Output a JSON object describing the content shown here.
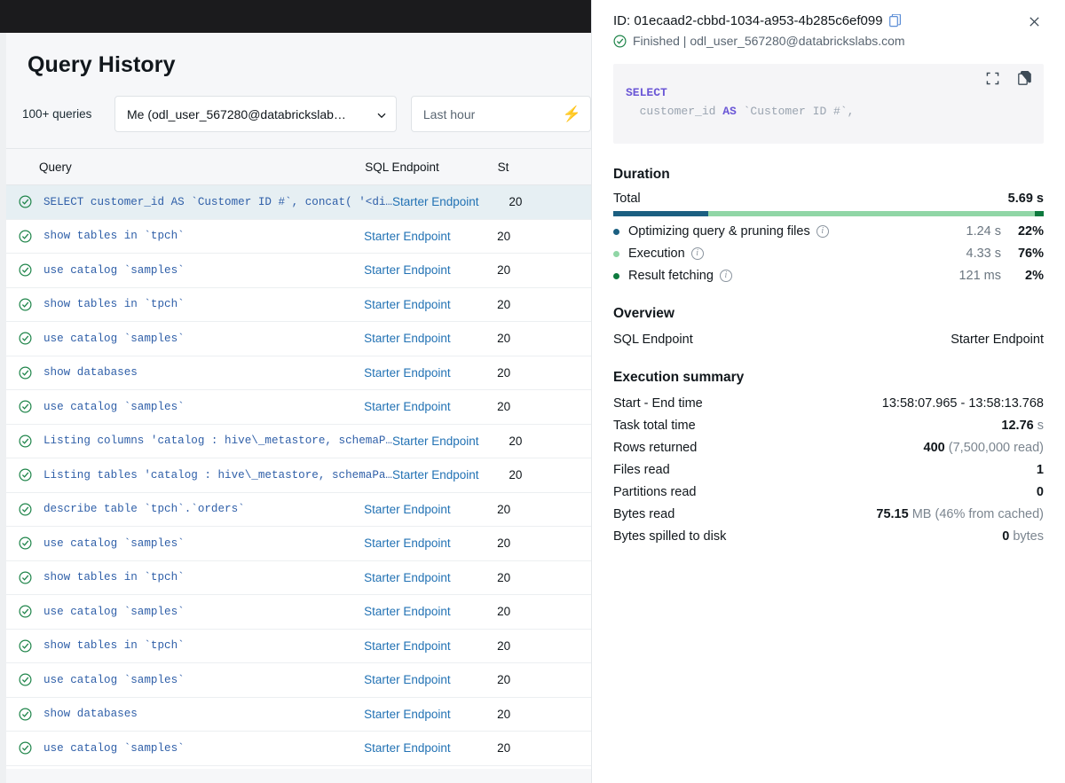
{
  "left": {
    "page_title": "Query History",
    "query_count_label": "100+ queries",
    "user_filter": {
      "value": "Me (odl_user_567280@databrickslab…",
      "icon": "chevron-down-icon"
    },
    "time_filter": {
      "placeholder": "Last hour",
      "icon": "lightning-bolt-icon"
    },
    "columns": {
      "query": "Query",
      "endpoint": "SQL Endpoint",
      "status": "St"
    },
    "rows": [
      {
        "status_icon": "check-circle-icon",
        "query": "SELECT customer_id AS `Customer ID #`, concat( '<di…",
        "endpoint": "Starter Endpoint",
        "started": "20",
        "selected": true
      },
      {
        "status_icon": "check-circle-icon",
        "query": "show tables in `tpch`",
        "endpoint": "Starter Endpoint",
        "started": "20",
        "selected": false
      },
      {
        "status_icon": "check-circle-icon",
        "query": "use catalog `samples`",
        "endpoint": "Starter Endpoint",
        "started": "20",
        "selected": false
      },
      {
        "status_icon": "check-circle-icon",
        "query": "show tables in `tpch`",
        "endpoint": "Starter Endpoint",
        "started": "20",
        "selected": false
      },
      {
        "status_icon": "check-circle-icon",
        "query": "use catalog `samples`",
        "endpoint": "Starter Endpoint",
        "started": "20",
        "selected": false
      },
      {
        "status_icon": "check-circle-icon",
        "query": "show databases",
        "endpoint": "Starter Endpoint",
        "started": "20",
        "selected": false
      },
      {
        "status_icon": "check-circle-icon",
        "query": "use catalog `samples`",
        "endpoint": "Starter Endpoint",
        "started": "20",
        "selected": false
      },
      {
        "status_icon": "check-circle-icon",
        "query": "Listing columns 'catalog : hive\\_metastore, schemaP…",
        "endpoint": "Starter Endpoint",
        "started": "20",
        "selected": false
      },
      {
        "status_icon": "check-circle-icon",
        "query": "Listing tables 'catalog : hive\\_metastore, schemaPa…",
        "endpoint": "Starter Endpoint",
        "started": "20",
        "selected": false
      },
      {
        "status_icon": "check-circle-icon",
        "query": "describe table `tpch`.`orders`",
        "endpoint": "Starter Endpoint",
        "started": "20",
        "selected": false
      },
      {
        "status_icon": "check-circle-icon",
        "query": "use catalog `samples`",
        "endpoint": "Starter Endpoint",
        "started": "20",
        "selected": false
      },
      {
        "status_icon": "check-circle-icon",
        "query": "show tables in `tpch`",
        "endpoint": "Starter Endpoint",
        "started": "20",
        "selected": false
      },
      {
        "status_icon": "check-circle-icon",
        "query": "use catalog `samples`",
        "endpoint": "Starter Endpoint",
        "started": "20",
        "selected": false
      },
      {
        "status_icon": "check-circle-icon",
        "query": "show tables in `tpch`",
        "endpoint": "Starter Endpoint",
        "started": "20",
        "selected": false
      },
      {
        "status_icon": "check-circle-icon",
        "query": "use catalog `samples`",
        "endpoint": "Starter Endpoint",
        "started": "20",
        "selected": false
      },
      {
        "status_icon": "check-circle-icon",
        "query": "show databases",
        "endpoint": "Starter Endpoint",
        "started": "20",
        "selected": false
      },
      {
        "status_icon": "check-circle-icon",
        "query": "use catalog `samples`",
        "endpoint": "Starter Endpoint",
        "started": "20",
        "selected": false
      }
    ]
  },
  "panel": {
    "id_text": "ID: 01ecaad2-cbbd-1034-a953-4b285c6ef099",
    "copy_id_icon": "copy-icon",
    "close_icon": "close-icon",
    "status_icon": "check-circle-icon",
    "status_text": "Finished | odl_user_567280@databrickslabs.com",
    "code": {
      "expand_icon": "expand-icon",
      "copy_icon": "copy-icon",
      "line1_keyword": "SELECT",
      "line2_ident": "  customer_id ",
      "line2_as": "AS",
      "line2_alias": " `Customer ID #`,"
    },
    "duration": {
      "title": "Duration",
      "total_label": "Total",
      "total_value": "5.69 s",
      "items": [
        {
          "label": "Optimizing query & pruning files",
          "info_icon": "info-icon",
          "time": "1.24 s",
          "pct": "22%",
          "pct_num": 22,
          "color": "#1b5f81"
        },
        {
          "label": "Execution",
          "info_icon": "info-icon",
          "time": "4.33 s",
          "pct": "76%",
          "pct_num": 76,
          "color": "#90d6a6"
        },
        {
          "label": "Result fetching",
          "info_icon": "info-icon",
          "time": "121 ms",
          "pct": "2%",
          "pct_num": 2,
          "color": "#0e7a3e"
        }
      ]
    },
    "overview": {
      "title": "Overview",
      "endpoint_label": "SQL Endpoint",
      "endpoint_value": "Starter Endpoint"
    },
    "execution_summary": {
      "title": "Execution summary",
      "rows": [
        {
          "label": "Start - End time",
          "value": "13:58:07.965 - 13:58:13.768",
          "style": "muted"
        },
        {
          "label": "Task total time",
          "value_strong": "12.76",
          "value_muted": " s"
        },
        {
          "label": "Rows returned",
          "value_strong": "400",
          "value_muted": " (7,500,000 read)"
        },
        {
          "label": "Files read",
          "value_strong": "1",
          "value_muted": ""
        },
        {
          "label": "Partitions read",
          "value_strong": "0",
          "value_muted": ""
        },
        {
          "label": "Bytes read",
          "value_strong": "75.15",
          "value_muted": " MB (46% from cached)"
        },
        {
          "label": "Bytes spilled to disk",
          "value_strong": "0",
          "value_muted": " bytes"
        }
      ]
    }
  },
  "colors": {
    "accent_link": "#2272b4",
    "success": "#1e8449",
    "bar_optimize": "#1b5f81",
    "bar_execution": "#90d6a6",
    "bar_fetch": "#0e7a3e",
    "topbar": "#1b1b1d"
  }
}
